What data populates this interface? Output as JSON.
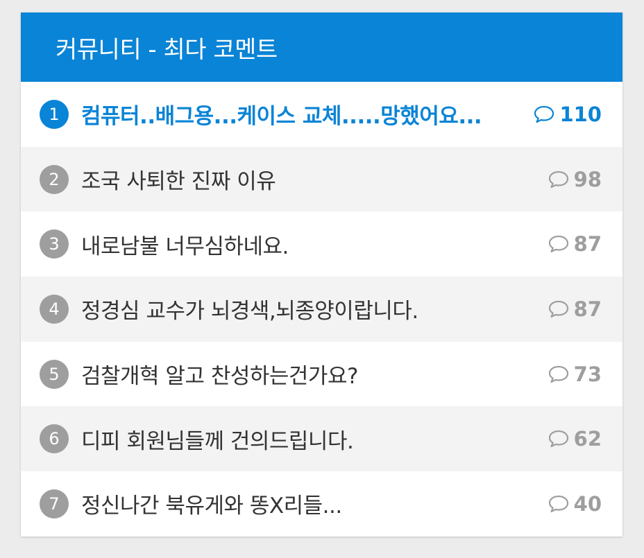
{
  "header": {
    "title": "커뮤니티 - 최다 코멘트"
  },
  "items": [
    {
      "rank": "1",
      "title": "컴퓨터..배그용...케이스 교체.....망했어요...",
      "count": "110"
    },
    {
      "rank": "2",
      "title": "조국 사퇴한 진짜 이유",
      "count": "98"
    },
    {
      "rank": "3",
      "title": "내로남불 너무심하네요.",
      "count": "87"
    },
    {
      "rank": "4",
      "title": "정경심 교수가 뇌경색,뇌종양이랍니다.",
      "count": "87"
    },
    {
      "rank": "5",
      "title": "검찰개혁 알고 찬성하는건가요?",
      "count": "73"
    },
    {
      "rank": "6",
      "title": "디피 회원님들께 건의드립니다.",
      "count": "62"
    },
    {
      "rank": "7",
      "title": "정신나간 북유게와 똥X리들...",
      "count": "40"
    }
  ],
  "icons": {
    "comment": "comment-bubble-icon"
  },
  "colors": {
    "accent": "#0a84d6",
    "muted": "#9e9e9e",
    "text": "#333333"
  }
}
